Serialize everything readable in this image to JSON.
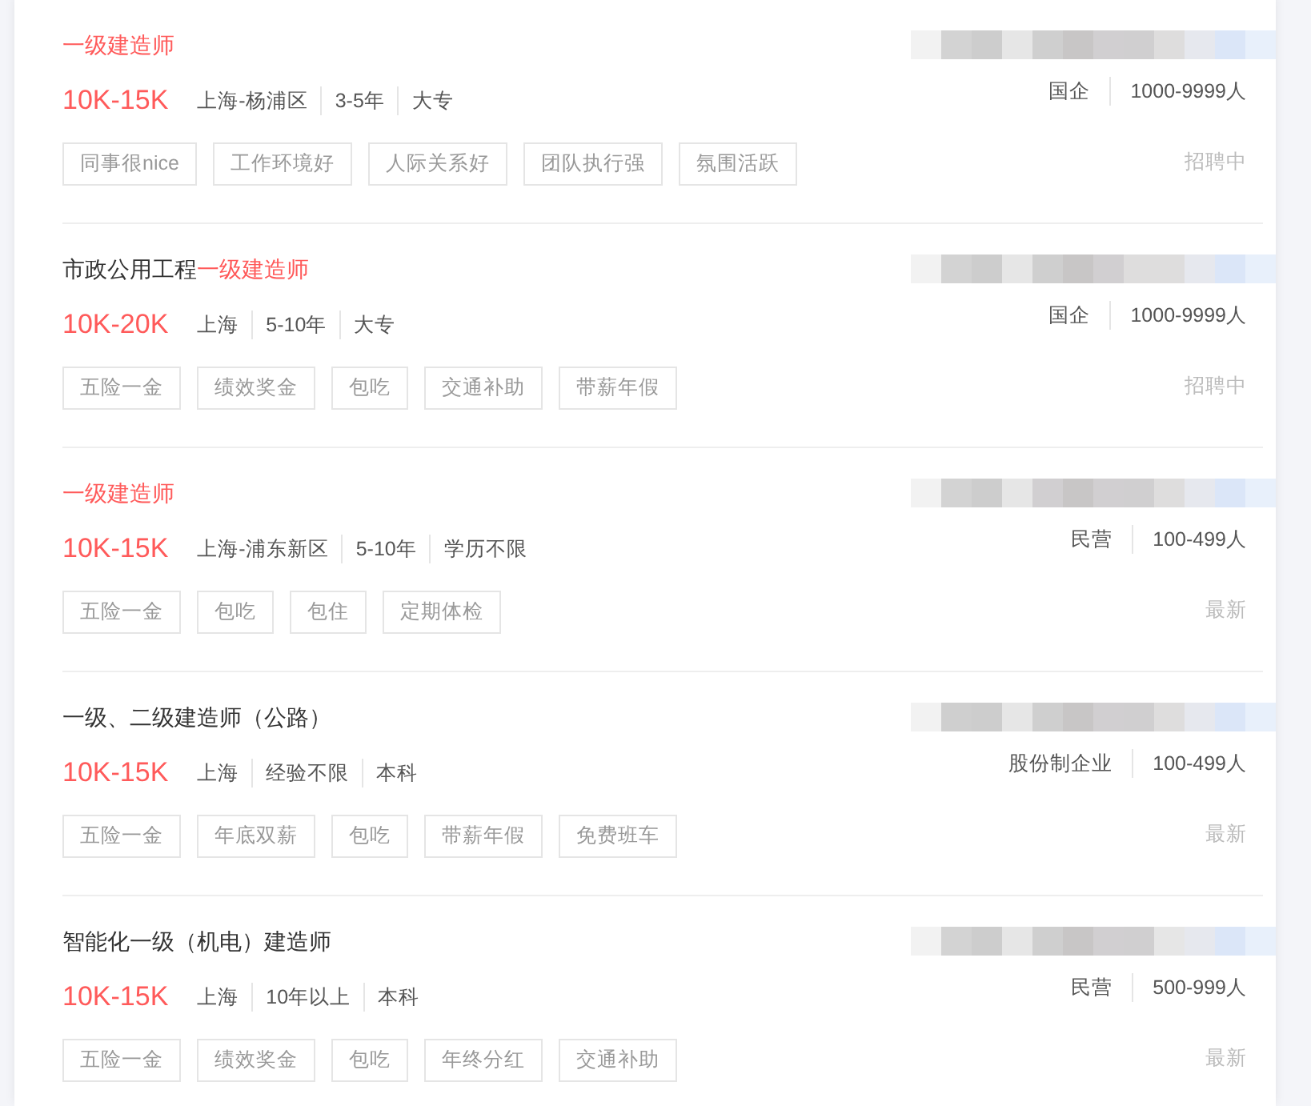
{
  "jobs": [
    {
      "title": [
        {
          "text": "一级建造师",
          "highlight": true
        }
      ],
      "salary": "10K-15K",
      "meta": [
        "上海-杨浦区",
        "3-5年",
        "大专"
      ],
      "tags": [
        "同事很nice",
        "工作环境好",
        "人际关系好",
        "团队执行强",
        "氛围活跃"
      ],
      "company_type": "国企",
      "company_size": "1000-9999人",
      "status": "招聘中"
    },
    {
      "title": [
        {
          "text": "市政公用工程",
          "highlight": false
        },
        {
          "text": "一级建造师",
          "highlight": true
        }
      ],
      "salary": "10K-20K",
      "meta": [
        "上海",
        "5-10年",
        "大专"
      ],
      "tags": [
        "五险一金",
        "绩效奖金",
        "包吃",
        "交通补助",
        "带薪年假"
      ],
      "company_type": "国企",
      "company_size": "1000-9999人",
      "status": "招聘中"
    },
    {
      "title": [
        {
          "text": "一级建造师",
          "highlight": true
        }
      ],
      "salary": "10K-15K",
      "meta": [
        "上海-浦东新区",
        "5-10年",
        "学历不限"
      ],
      "tags": [
        "五险一金",
        "包吃",
        "包住",
        "定期体检"
      ],
      "company_type": "民营",
      "company_size": "100-499人",
      "status": "最新"
    },
    {
      "title": [
        {
          "text": "一级、二级建造师（公路）",
          "highlight": false
        }
      ],
      "salary": "10K-15K",
      "meta": [
        "上海",
        "经验不限",
        "本科"
      ],
      "tags": [
        "五险一金",
        "年底双薪",
        "包吃",
        "带薪年假",
        "免费班车"
      ],
      "company_type": "股份制企业",
      "company_size": "100-499人",
      "status": "最新"
    },
    {
      "title": [
        {
          "text": "智能化一级（机电）建造师",
          "highlight": false
        }
      ],
      "salary": "10K-15K",
      "meta": [
        "上海",
        "10年以上",
        "本科"
      ],
      "tags": [
        "五险一金",
        "绩效奖金",
        "包吃",
        "年终分红",
        "交通补助"
      ],
      "company_type": "民营",
      "company_size": "500-999人",
      "status": "最新"
    }
  ]
}
